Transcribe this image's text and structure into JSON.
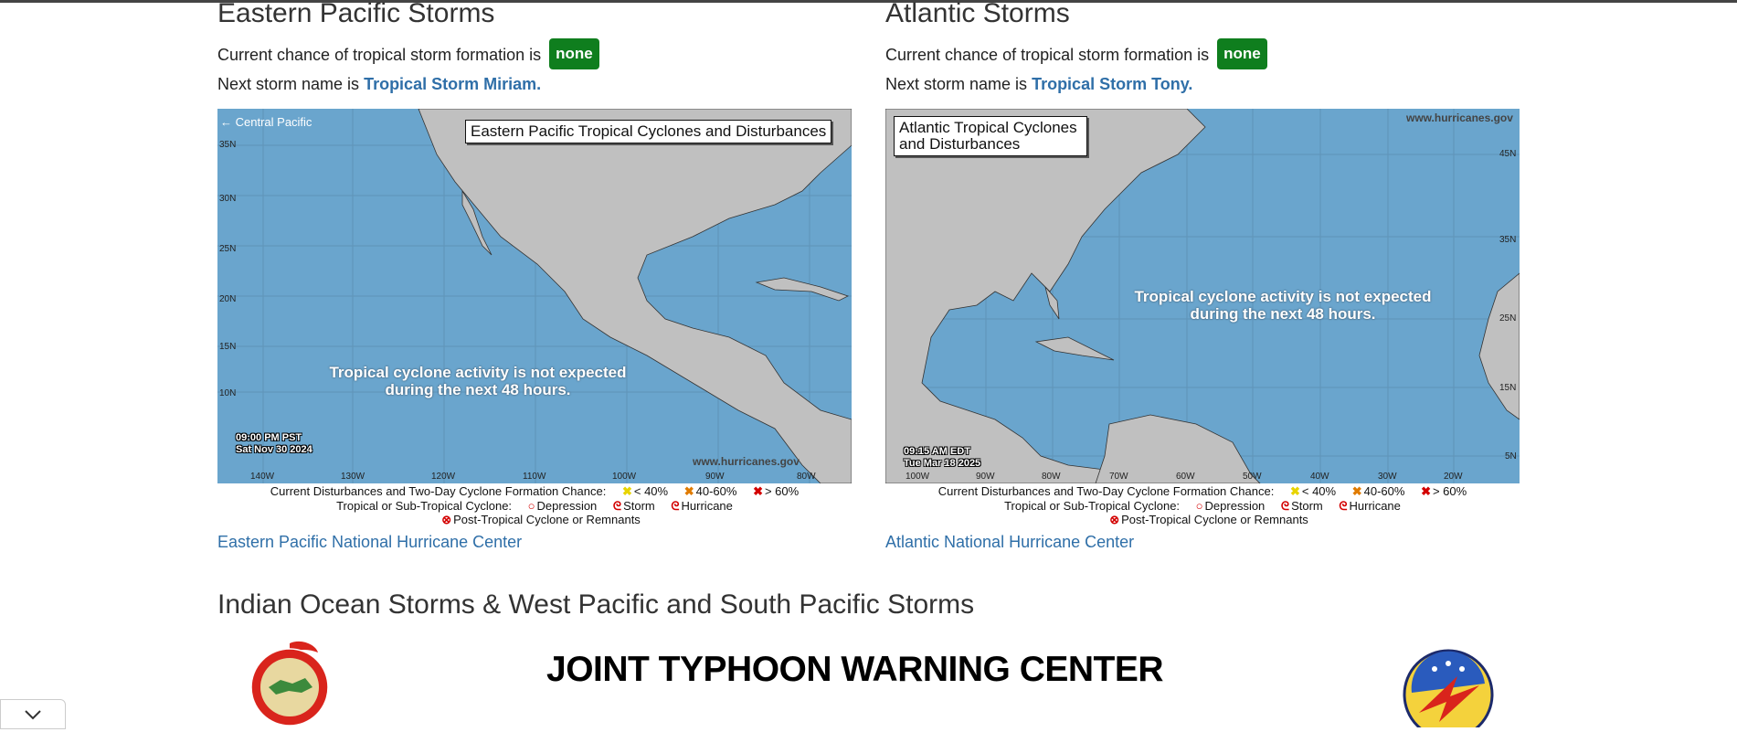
{
  "eastern": {
    "title": "Eastern Pacific Storms",
    "chance_text": "Current chance of tropical storm formation is",
    "chance_badge": "none",
    "next_text": "Next storm name is",
    "next_name": "Tropical Storm Miriam.",
    "map": {
      "title": "Eastern Pacific Tropical Cyclones and Disturbances",
      "central_link": "Central Pacific",
      "message": "Tropical cyclone activity is not expected during the next 48 hours.",
      "time_line1": "09:00 PM PST",
      "time_line2": "Sat Nov 30 2024",
      "credit": "www.hurricanes.gov",
      "lat_labels": [
        "35N",
        "30N",
        "25N",
        "20N",
        "15N",
        "10N"
      ],
      "lon_labels": [
        "140W",
        "130W",
        "120W",
        "110W",
        "100W",
        "90W",
        "80W"
      ]
    },
    "link": "Eastern Pacific National Hurricane Center"
  },
  "atlantic": {
    "title": "Atlantic Storms",
    "chance_text": "Current chance of tropical storm formation is",
    "chance_badge": "none",
    "next_text": "Next storm name is",
    "next_name": "Tropical Storm Tony.",
    "map": {
      "title": "Atlantic Tropical Cyclones and Disturbances",
      "message": "Tropical cyclone activity is not expected during the next 48 hours.",
      "time_line1": "09:15 AM EDT",
      "time_line2": "Tue Mar 18 2025",
      "credit": "www.hurricanes.gov",
      "lat_labels": [
        "45N",
        "35N",
        "25N",
        "15N",
        "5N"
      ],
      "lon_labels": [
        "100W",
        "90W",
        "80W",
        "70W",
        "60W",
        "50W",
        "40W",
        "30W",
        "20W"
      ]
    },
    "link": "Atlantic National Hurricane Center"
  },
  "legend": {
    "disturbances_label": "Current Disturbances and Two-Day Cyclone Formation Chance:",
    "low": "< 40%",
    "mid": "40-60%",
    "high": "> 60%",
    "tropical_label": "Tropical or Sub-Tropical Cyclone:",
    "depression": "Depression",
    "storm": "Storm",
    "hurricane": "Hurricane",
    "post_tropical": "Post-Tropical Cyclone or Remnants"
  },
  "indian": {
    "title": "Indian Ocean Storms & West Pacific and South Pacific Storms",
    "jtwc_title": "JOINT TYPHOON WARNING CENTER"
  },
  "colors": {
    "ocean": "#6aa5cd",
    "land": "#c0c0c0",
    "badge": "#0f7e1e",
    "link": "#2f6fa8"
  },
  "icons": {
    "collapse_toggle": "chevron-down-icon",
    "jtwc_logo": "jtwc-emblem-icon",
    "squadron_logo": "squadron-emblem-icon"
  }
}
